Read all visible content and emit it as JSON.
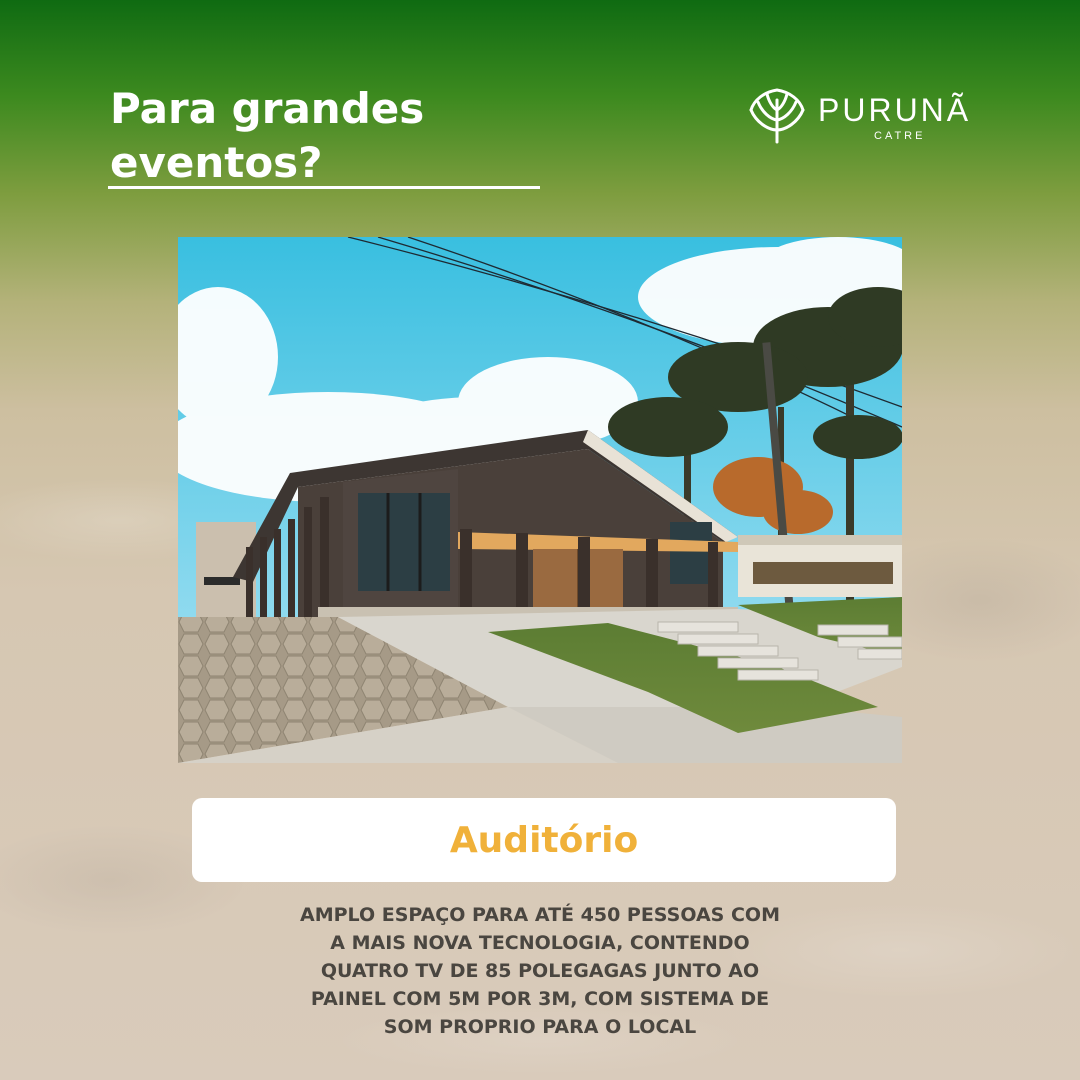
{
  "headline": {
    "lines": [
      "Para grandes",
      "eventos?"
    ]
  },
  "logo": {
    "name": "PURUNÃ",
    "subtitle": "CATRE",
    "icon": "palm-leaf-icon"
  },
  "photo": {
    "subject": "auditorium-building-photo"
  },
  "label": {
    "text": "Auditório",
    "color": "#f0b13a"
  },
  "description": {
    "lines": [
      "AMPLO ESPAÇO PARA ATÉ 450 PESSOAS COM",
      "A MAIS NOVA TECNOLOGIA, CONTENDO",
      "QUATRO TV DE 85 POLEGAGAS JUNTO AO",
      "PAINEL COM 5M POR 3M, COM SISTEMA DE",
      "SOM PROPRIO PARA O LOCAL"
    ]
  },
  "colors": {
    "top_green": "#0f6b12",
    "paper": "#d9cbbb",
    "text_dark": "#4a4640"
  }
}
